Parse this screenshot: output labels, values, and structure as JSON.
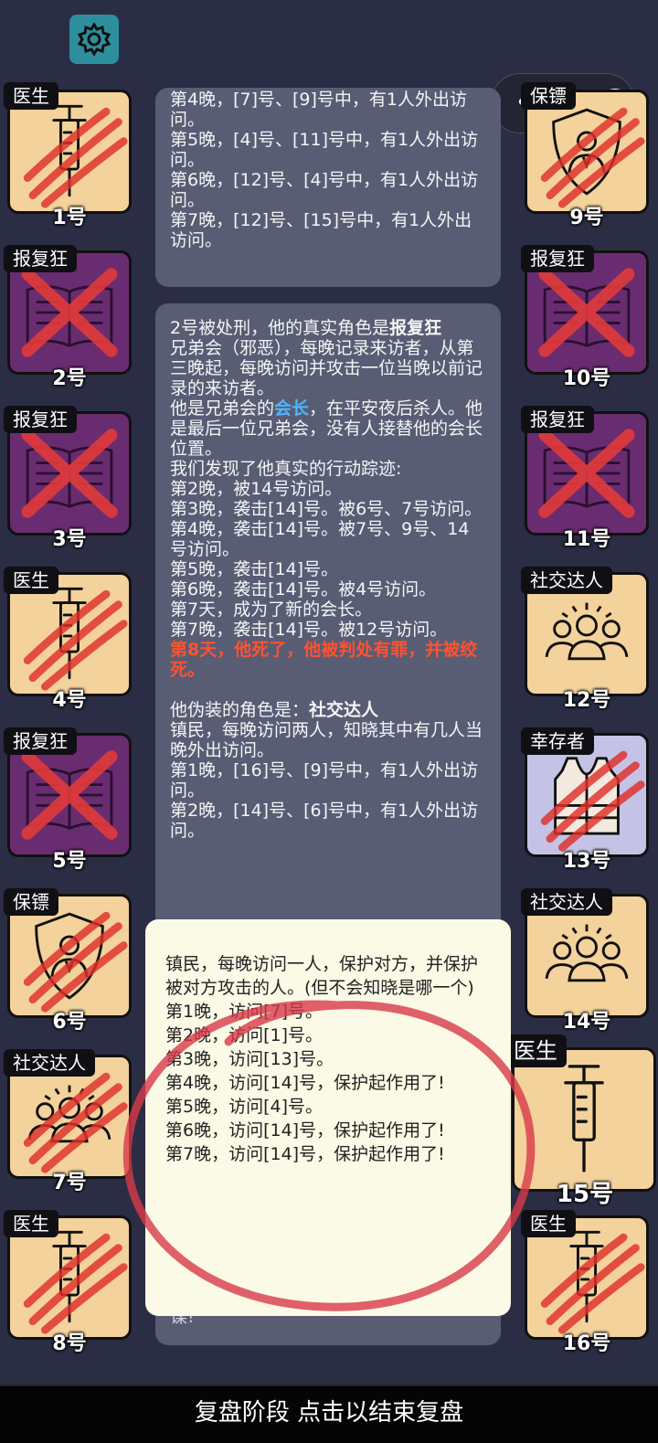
{
  "settings_icon": "gear-icon",
  "top_right": {
    "more_icon": "more-dots-icon",
    "close_icon": "record-circle-icon"
  },
  "players": {
    "p1": {
      "role": "医生",
      "number": "1号",
      "icon": "syringe-icon",
      "status": "slashed"
    },
    "p2": {
      "role": "报复狂",
      "number": "2号",
      "icon": "book-icon",
      "status": "crossed"
    },
    "p3": {
      "role": "报复狂",
      "number": "3号",
      "icon": "book-icon",
      "status": "crossed"
    },
    "p4": {
      "role": "医生",
      "number": "4号",
      "icon": "syringe-icon",
      "status": "slashed"
    },
    "p5": {
      "role": "报复狂",
      "number": "5号",
      "icon": "book-icon",
      "status": "crossed"
    },
    "p6": {
      "role": "保镖",
      "number": "6号",
      "icon": "shield-person-icon",
      "status": "slashed"
    },
    "p7": {
      "role": "社交达人",
      "number": "7号",
      "icon": "people-group-icon",
      "status": "slashed"
    },
    "p8": {
      "role": "医生",
      "number": "8号",
      "icon": "syringe-icon",
      "status": "slashed"
    },
    "p9": {
      "role": "保镖",
      "number": "9号",
      "icon": "shield-person-icon",
      "status": "slashed"
    },
    "p10": {
      "role": "报复狂",
      "number": "10号",
      "icon": "book-icon",
      "status": "crossed"
    },
    "p11": {
      "role": "报复狂",
      "number": "11号",
      "icon": "book-icon",
      "status": "crossed"
    },
    "p12": {
      "role": "社交达人",
      "number": "12号",
      "icon": "people-group-icon",
      "status": "alive"
    },
    "p13": {
      "role": "幸存者",
      "number": "13号",
      "icon": "vest-icon",
      "status": "slashed"
    },
    "p14": {
      "role": "社交达人",
      "number": "14号",
      "icon": "people-group-icon",
      "status": "alive"
    },
    "p15": {
      "role": "医生",
      "number": "15号",
      "icon": "syringe-icon",
      "status": "alive"
    },
    "p16": {
      "role": "医生",
      "number": "16号",
      "icon": "syringe-icon",
      "status": "slashed"
    }
  },
  "log_top": {
    "lines": [
      "第4晚，[7]号、[9]号中，有1人外出访问。",
      "第5晚，[4]号、[11]号中，有1人外出访问。",
      "第6晚，[12]号、[4]号中，有1人外出访问。",
      "第7晚，[12]号、[15]号中，有1人外出访问。"
    ]
  },
  "log_main": {
    "intro_prefix": "2号被处刑，他的真实角色是",
    "real_role": "报复狂",
    "desc": "兄弟会（邪恶），每晚记录来访者，从第三晚起，每晚访问并攻击一位当晚以前记录的来访者。",
    "leader_prefix": "他是兄弟会的",
    "leader_word": "会长",
    "leader_suffix": "，在平安夜后杀人。他是最后一位兄弟会，没有人接替他的会长位置。",
    "track_title": "我们发现了他真实的行动踪迹:",
    "track": [
      "第2晚，被14号访问。",
      "第3晚，袭击[14]号。被6号、7号访问。",
      "第4晚，袭击[14]号。被7号、9号、14号访问。",
      "第5晚，袭击[14]号。",
      "第6晚，袭击[14]号。被4号访问。",
      "第7天，成为了新的会长。",
      "第7晚，袭击[14]号。被12号访问。"
    ],
    "death": "第8天，他死了，他被判处有罪，并被绞死。",
    "fake_prefix": "他伪装的角色是：",
    "fake_role": "社交达人",
    "fake_desc": "镇民，每晚访问两人，知晓其中有几人当晚外出访问。",
    "fake_track": [
      "第1晚，[16]号、[9]号中，有1人外出访问。",
      "第2晚，[14]号、[6]号中，有1人外出访问。"
    ],
    "tail": "谋!"
  },
  "popup": {
    "desc": "镇民，每晚访问一人，保护对方，并保护被对方攻击的人。(但不会知晓是哪一个)",
    "lines": [
      "第1晚，访问[7]号。",
      "第2晚，访问[1]号。",
      "第3晚，访问[13]号。",
      "第4晚，访问[14]号，保护起作用了!",
      "第5晚，访问[4]号。",
      "第6晚，访问[14]号，保护起作用了!",
      "第7晚，访问[14]号，保护起作用了!"
    ]
  },
  "bottom_bar": "复盘阶段 点击以结束复盘",
  "colors": {
    "card_tan": "#f3d29c",
    "card_purple": "#6a2c70",
    "card_lavender": "#c4c3e6",
    "slash_red": "#e0302a",
    "leader_blue": "#4fb6ff",
    "death_red": "#ff5230"
  }
}
